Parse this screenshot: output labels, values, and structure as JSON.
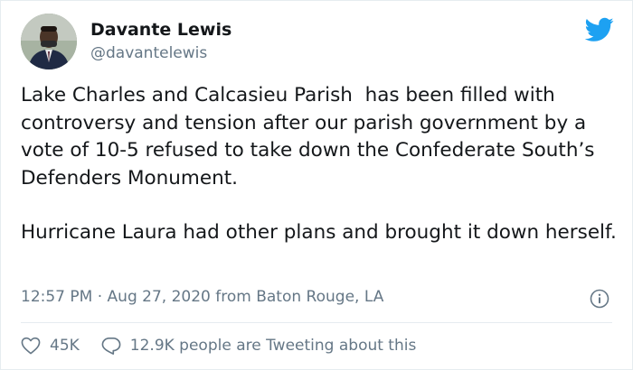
{
  "user": {
    "name": "Davante Lewis",
    "handle": "@davantelewis"
  },
  "icons": {
    "logo": "twitter-bird-icon",
    "info": "info-icon",
    "like": "heart-icon",
    "reply": "speech-bubble-icon"
  },
  "colors": {
    "brand": "#1da1f2",
    "muted": "#657786",
    "text": "#14171a"
  },
  "tweet": {
    "paragraph1": "Lake Charles and Calcasieu Parish  has been filled with controversy and tension after our parish government by a vote of 10-5 refused to take down the Confederate South’s Defenders Monument.",
    "paragraph2": "Hurricane Laura had other plans and brought it down herself."
  },
  "meta": {
    "time": "12:57 PM",
    "separator": "·",
    "date": "Aug 27, 2020",
    "source": "from Baton Rouge, LA"
  },
  "actions": {
    "likes": "45K",
    "discussion": "12.9K people are Tweeting about this"
  }
}
